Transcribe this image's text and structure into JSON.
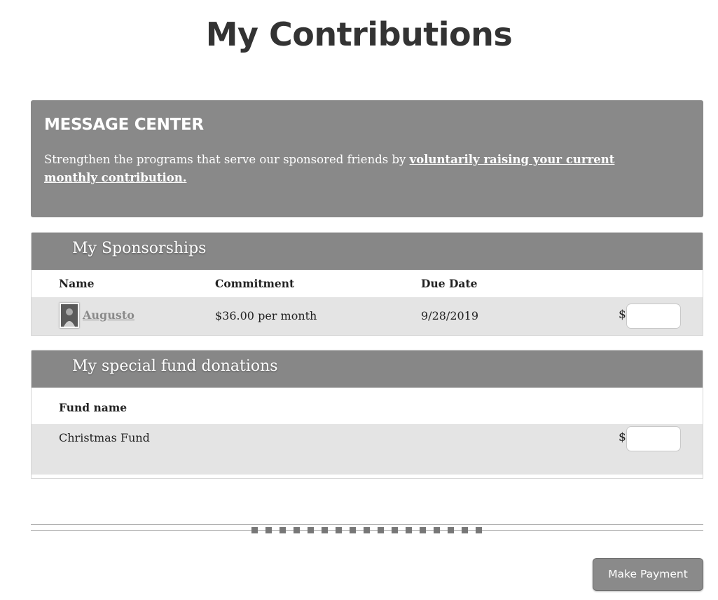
{
  "page_title": "My Contributions",
  "message_center": {
    "title": "MESSAGE CENTER",
    "text": "Strengthen the programs that serve our sponsored friends by ",
    "link": "voluntarily raising your current monthly contribution."
  },
  "sponsorships": {
    "title": "My Sponsorships",
    "columns": [
      "Name",
      "Commitment",
      "Due Date"
    ],
    "rows": [
      {
        "name": "Augusto",
        "commitment": "$36.00 per month",
        "due_date": "9/28/2019",
        "currency": "$",
        "amount": ""
      }
    ]
  },
  "fund_donations": {
    "title": "My special fund donations",
    "columns": [
      "Fund name"
    ],
    "rows": [
      {
        "fund_name": "Christmas Fund",
        "currency": "$",
        "amount": ""
      }
    ]
  },
  "make_payment_label": "Make Payment"
}
